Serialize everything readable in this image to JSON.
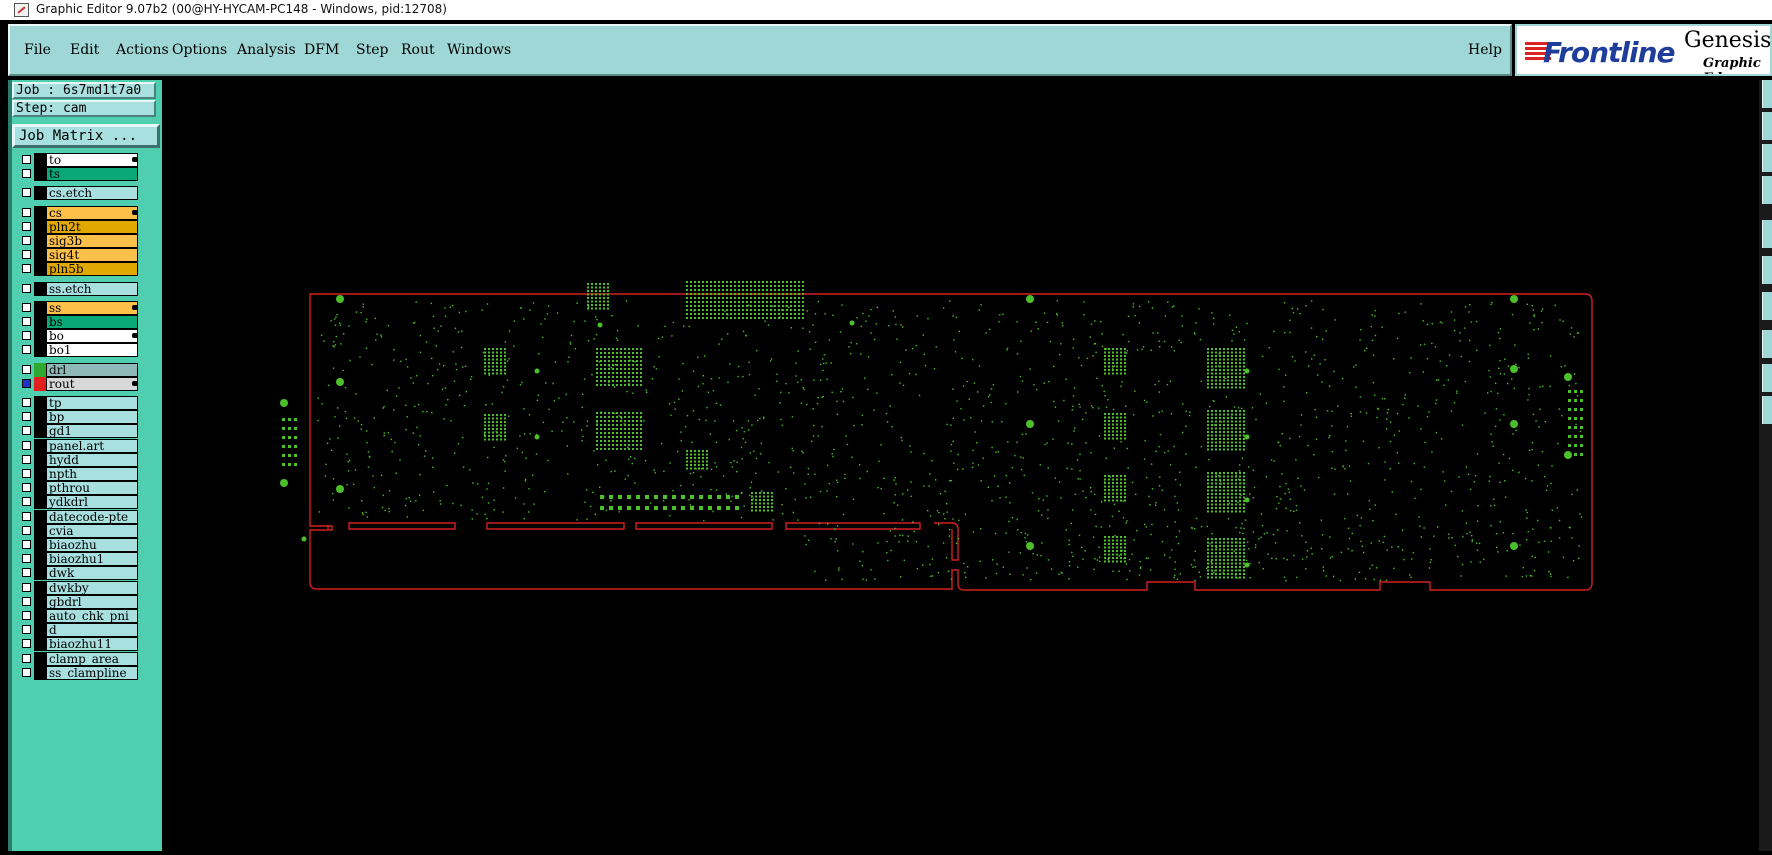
{
  "window": {
    "title": "Graphic Editor 9.07b2 (00@HY-HYCAM-PC148 - Windows, pid:12708)"
  },
  "menu": {
    "items": [
      {
        "label": "File"
      },
      {
        "label": "Edit"
      },
      {
        "label": "Actions"
      },
      {
        "label": "Options"
      },
      {
        "label": "Analysis"
      },
      {
        "label": "DFM"
      },
      {
        "label": "Step"
      },
      {
        "label": "Rout"
      },
      {
        "label": "Windows"
      }
    ],
    "help": "Help"
  },
  "logo": {
    "brand": "Frontline",
    "product": "Genesis",
    "subtitle": "Graphic Ed"
  },
  "job": {
    "job_label": "Job : 6s7md1t7a0",
    "step_label": "Step: cam",
    "matrix_button": "Job Matrix ..."
  },
  "layers": [
    {
      "name": "to",
      "color": "#ffffff",
      "marker": true
    },
    {
      "name": "ts",
      "color": "#0aa878",
      "marker": false
    },
    {
      "name": "cs.etch",
      "color": "#a8e0e0",
      "marker": false
    },
    {
      "name": "cs",
      "color": "#ffc04a",
      "marker": true
    },
    {
      "name": "pln2t",
      "color": "#e0a800",
      "marker": false
    },
    {
      "name": "sig3b",
      "color": "#ffc04a",
      "marker": false
    },
    {
      "name": "sig4t",
      "color": "#ffc04a",
      "marker": false
    },
    {
      "name": "pln5b",
      "color": "#e0a800",
      "marker": false
    },
    {
      "name": "ss.etch",
      "color": "#a8e0e0",
      "marker": false
    },
    {
      "name": "ss",
      "color": "#ffc04a",
      "marker": true
    },
    {
      "name": "bs",
      "color": "#0aa878",
      "marker": false
    },
    {
      "name": "bo",
      "color": "#ffffff",
      "marker": true
    },
    {
      "name": "bo1",
      "color": "#ffffff",
      "marker": false
    },
    {
      "name": "drl",
      "color": "#8fb8b8",
      "marker": false
    },
    {
      "name": "rout",
      "color": "#d8d8d8",
      "marker": true
    },
    {
      "name": "tp",
      "color": "#a8e0e0",
      "marker": false
    },
    {
      "name": "bp",
      "color": "#a8e0e0",
      "marker": false
    },
    {
      "name": "gd1",
      "color": "#a8e0e0",
      "marker": false
    },
    {
      "name": "panel.art",
      "color": "#a8e0e0",
      "marker": false
    },
    {
      "name": "hydd",
      "color": "#a8e0e0",
      "marker": false
    },
    {
      "name": "npth",
      "color": "#a8e0e0",
      "marker": false
    },
    {
      "name": "pthrou",
      "color": "#a8e0e0",
      "marker": false
    },
    {
      "name": "ydkdrl",
      "color": "#a8e0e0",
      "marker": false
    },
    {
      "name": "datecode-pte",
      "color": "#a8e0e0",
      "marker": false
    },
    {
      "name": "cvia",
      "color": "#a8e0e0",
      "marker": false
    },
    {
      "name": "biaozhu",
      "color": "#a8e0e0",
      "marker": false
    },
    {
      "name": "biaozhu1",
      "color": "#a8e0e0",
      "marker": false
    },
    {
      "name": "dwk",
      "color": "#a8e0e0",
      "marker": false
    },
    {
      "name": "dwkby",
      "color": "#a8e0e0",
      "marker": false
    },
    {
      "name": "gbdrl",
      "color": "#a8e0e0",
      "marker": false
    },
    {
      "name": "auto_chk_pni",
      "color": "#a8e0e0",
      "marker": false
    },
    {
      "name": "d",
      "color": "#a8e0e0",
      "marker": false
    },
    {
      "name": "biaozhu11",
      "color": "#a8e0e0",
      "marker": false
    },
    {
      "name": "clamp_area",
      "color": "#a8e0e0",
      "marker": false
    },
    {
      "name": "ss_clampline",
      "color": "#a8e0e0",
      "marker": false
    }
  ],
  "colors": {
    "board_outline": "#d22020",
    "pad_color": "#4cc02a",
    "panel_bg": "#50cfb0",
    "menu_bg": "#9fd7d7"
  }
}
